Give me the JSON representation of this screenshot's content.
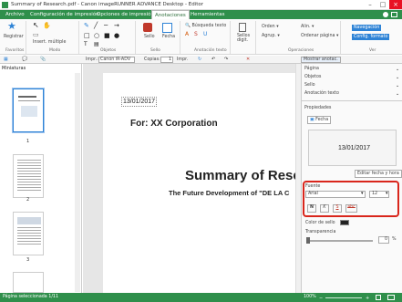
{
  "window": {
    "title": "Summary of Research.pdf - Canon imageRUNNER ADVANCE Desktop - Editor"
  },
  "menu": {
    "tabs": [
      "Archivo",
      "Configuración de impresión",
      "Opciones de impresión",
      "Anotaciones",
      "Herramientas"
    ],
    "active": "Anotaciones"
  },
  "ribbon": {
    "register": "Registrar",
    "insert_multiple": "Insert. múltiple",
    "sello": "Sello",
    "fecha": "Fecha",
    "search_text": "Búsqueda texto",
    "sellos_digit": "Sellos digit.",
    "ordenar": "Orden ▾",
    "agrupar": "Agrup. ▾",
    "alin": "Alin. ▾",
    "ordenar_pagina": "Ordenar página ▾",
    "navegacion": "Navegación",
    "config_formato": "Config. formato",
    "groups": [
      "Favoritos",
      "Modo",
      "Objetos",
      "Sello",
      "Anotación texto",
      "Operaciones",
      "Ver"
    ]
  },
  "toolbar2": {
    "printer_label": "Impr.:",
    "printer": "Canon iR-ADV",
    "copies_label": "Copias:",
    "copies": "1",
    "print_btn": "Impr.",
    "show_annot": "Mostrar anotac."
  },
  "left": {
    "title": "Miniaturas",
    "pages": [
      "1",
      "2",
      "3"
    ]
  },
  "doc": {
    "date": "13/01/2017",
    "for": "For: XX Corporation",
    "title": "Summary of Rese",
    "subtitle": "The Future Development of \"DE LA C"
  },
  "right": {
    "sections": [
      "Página",
      "Objetos",
      "Sello",
      "Anotación texto"
    ],
    "properties": "Propiedades",
    "fecha_tab": "Fecha",
    "preview_date": "13/01/2017",
    "edit_btn": "Editar fecha y hora",
    "fuente": "Fuente",
    "font": "Arial",
    "size": "12",
    "styles": [
      "N",
      "K",
      "S",
      "abc"
    ],
    "color_label": "Color de sello",
    "transparencia": "Transparencia",
    "transp_value": "0",
    "transp_unit": "%"
  },
  "status": {
    "text": "Página seleccionada 1/11",
    "zoom": "100%"
  }
}
